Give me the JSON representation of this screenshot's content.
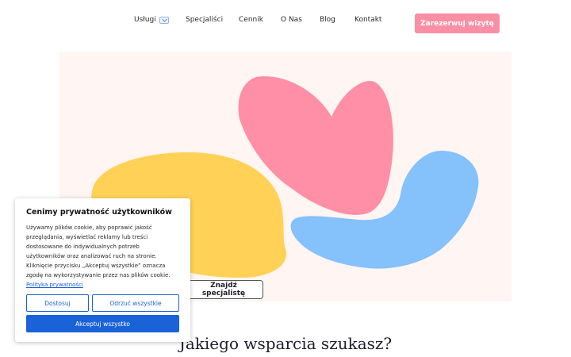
{
  "nav": {
    "items": [
      {
        "label": "Usługi",
        "has_dropdown": true
      },
      {
        "label": "Specjaliści"
      },
      {
        "label": "Cennik"
      },
      {
        "label": "O Nas"
      },
      {
        "label": "Blog"
      },
      {
        "label": "Kontakt"
      }
    ],
    "cta_label": "Zarezerwuj wizytę"
  },
  "hero": {
    "find_button_label": "Znajdź specjalistę",
    "colors": {
      "background": "#fff5f2",
      "pink_shape": "#ff8fa6",
      "yellow_shape": "#ffd257",
      "blue_shape": "#85c1fb"
    }
  },
  "section": {
    "heading": "Jakiego wsparcia szukasz?"
  },
  "cookie_banner": {
    "title": "Cenimy prywatność użytkowników",
    "body": "Używamy plików cookie, aby poprawić jakość przeglądania, wyświetlać reklamy lub treści dostosowane do indywidualnych potrzeb użytkowników oraz analizować ruch na stronie. Kliknięcie przycisku „Akceptuj wszystkie” oznacza zgodę na wykorzystywanie przez nas plików cookie.",
    "policy_link": "Polityka prywatności",
    "customize_label": "Dostosuj",
    "reject_label": "Odrzuć wszystkie",
    "accept_label": "Akceptuj wszystko"
  },
  "colors": {
    "cta": "#f98fa5",
    "cookie_primary": "#1a62d8"
  }
}
